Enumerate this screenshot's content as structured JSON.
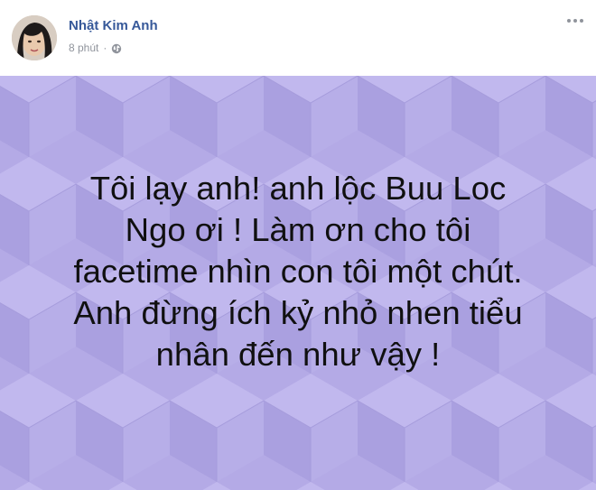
{
  "post": {
    "author_name": "Nhật Kim Anh",
    "timestamp": "8 phút",
    "separator": "·",
    "privacy_icon": "globe-icon",
    "options_icon": "more-options-icon",
    "text_lines": [
      "Tôi lạy anh! anh lộc Buu Loc",
      "Ngo ơi ! Làm ơn cho tôi",
      "facetime nhìn con tôi một chút.",
      "Anh đừng ích kỷ nhỏ nhen tiểu",
      "nhân đến như vậy !"
    ],
    "background_color": "#b5abe6",
    "text_color": "#101010",
    "author_color": "#365899"
  }
}
